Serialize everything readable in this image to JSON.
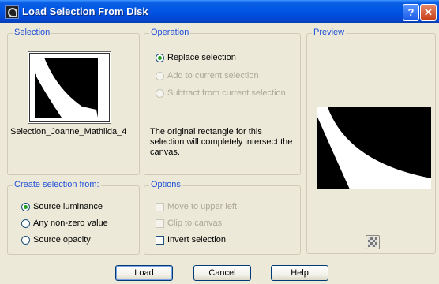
{
  "window": {
    "title": "Load Selection From Disk",
    "help_glyph": "?",
    "close_glyph": "✕"
  },
  "selection": {
    "legend": "Selection",
    "name": "Selection_Joanne_Mathilda_4"
  },
  "operation": {
    "legend": "Operation",
    "options": [
      {
        "label": "Replace selection",
        "checked": true,
        "enabled": true
      },
      {
        "label": "Add to current selection",
        "checked": false,
        "enabled": false
      },
      {
        "label": "Subtract from current selection",
        "checked": false,
        "enabled": false
      }
    ],
    "note": "The original rectangle for this selection will completely intersect the canvas."
  },
  "preview": {
    "legend": "Preview"
  },
  "create_from": {
    "legend": "Create selection from:",
    "options": [
      {
        "label": "Source luminance",
        "checked": true
      },
      {
        "label": "Any non-zero value",
        "checked": false
      },
      {
        "label": "Source opacity",
        "checked": false
      }
    ]
  },
  "options_group": {
    "legend": "Options",
    "items": [
      {
        "label": "Move to upper left",
        "checked": false,
        "enabled": false
      },
      {
        "label": "Clip to canvas",
        "checked": false,
        "enabled": false
      },
      {
        "label": "Invert selection",
        "checked": false,
        "enabled": true
      }
    ]
  },
  "buttons": {
    "load": "Load",
    "cancel": "Cancel",
    "help": "Help"
  },
  "colors": {
    "title_bar": "#0054e3",
    "dialog_bg": "#ece9d8",
    "legend_text": "#1f4fd8"
  }
}
